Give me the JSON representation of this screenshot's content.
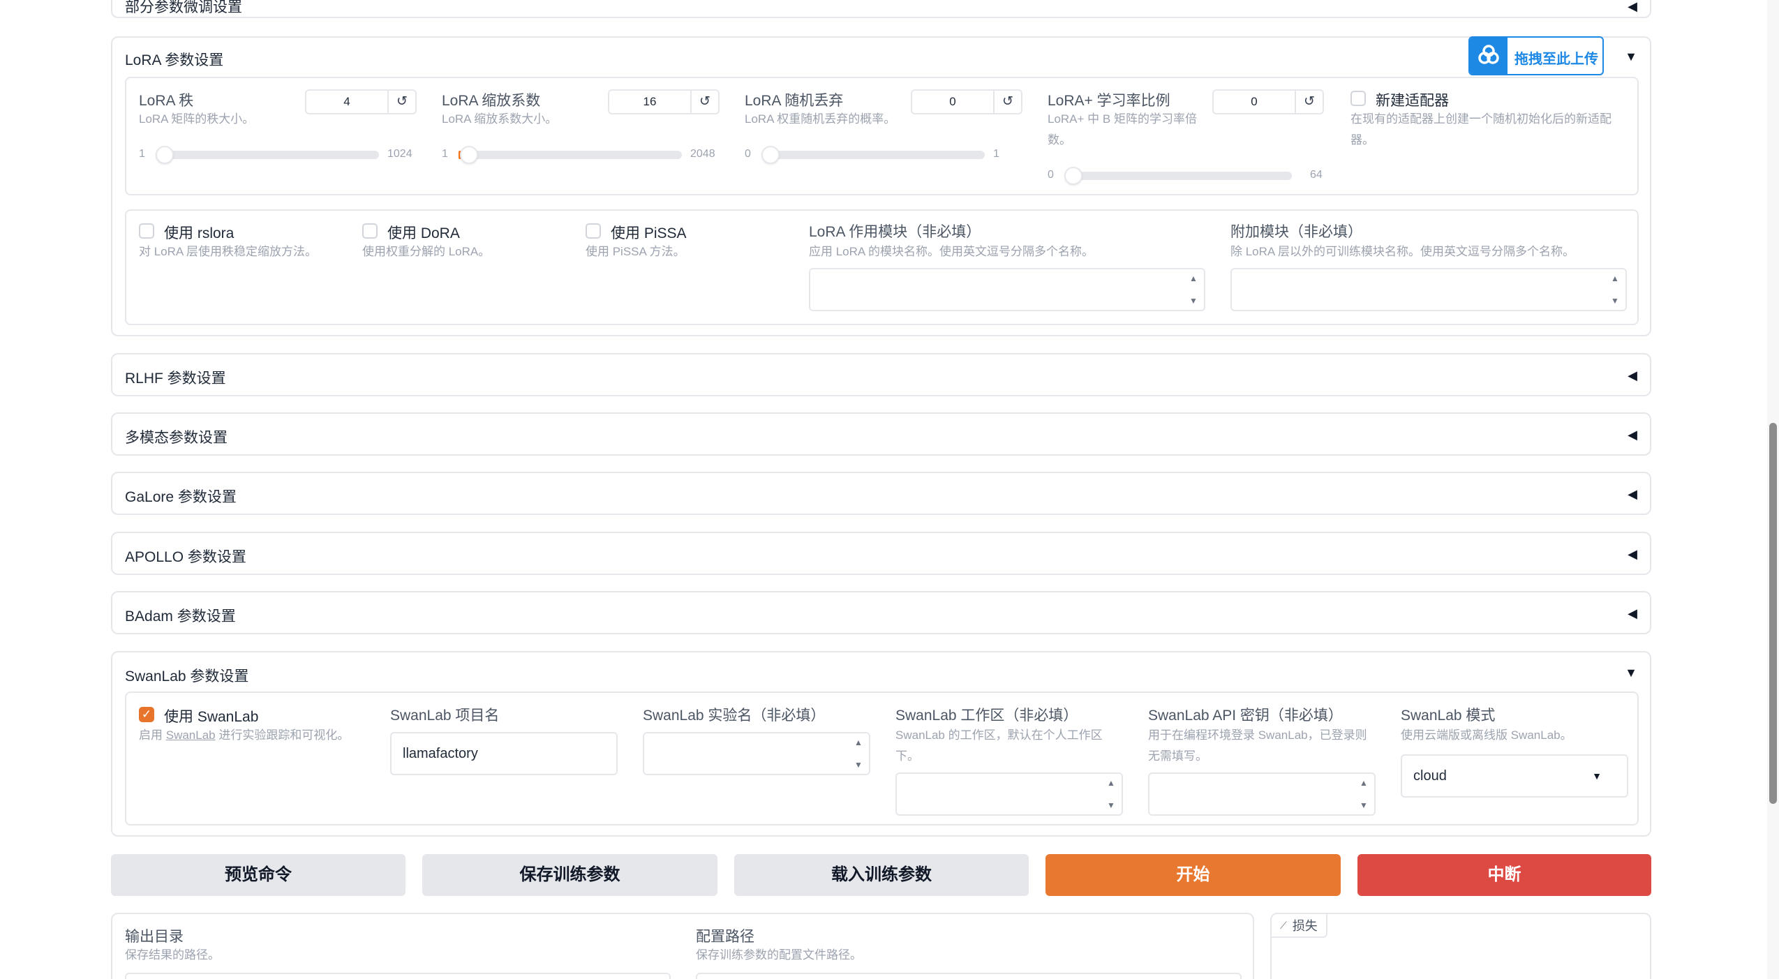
{
  "sections": {
    "partial": {
      "title": "部分参数微调设置"
    },
    "lora": {
      "title": "LoRA 参数设置"
    },
    "rlhf": {
      "title": "RLHF 参数设置"
    },
    "multimodal": {
      "title": "多模态参数设置"
    },
    "galore": {
      "title": "GaLore 参数设置"
    },
    "apollo": {
      "title": "APOLLO 参数设置"
    },
    "badam": {
      "title": "BAdam 参数设置"
    },
    "swanlab": {
      "title": "SwanLab 参数设置"
    }
  },
  "upload_badge": {
    "label": "拖拽至此上传",
    "icon": "cloud-upload-icon",
    "color": "#1e88e5"
  },
  "lora": {
    "rank": {
      "label": "LoRA 秩",
      "info": "LoRA 矩阵的秩大小。",
      "value": "4",
      "min": "1",
      "max": "1024",
      "fraction": 0.003
    },
    "alpha": {
      "label": "LoRA 缩放系数",
      "info": "LoRA 缩放系数大小。",
      "value": "16",
      "min": "1",
      "max": "2048",
      "fraction": 0.007
    },
    "dropout": {
      "label": "LoRA 随机丢弃",
      "info": "LoRA 权重随机丢弃的概率。",
      "value": "0",
      "min": "0",
      "max": "1",
      "fraction": 0
    },
    "plus_ratio": {
      "label": "LoRA+ 学习率比例",
      "info": "LoRA+ 中 B 矩阵的学习率倍数。",
      "value": "0",
      "min": "0",
      "max": "64",
      "fraction": 0
    },
    "create_new_adapter": {
      "label": "新建适配器",
      "info": "在现有的适配器上创建一个随机初始化后的新适配器。",
      "checked": false
    },
    "use_rslora": {
      "label": "使用 rslora",
      "info": "对 LoRA 层使用秩稳定缩放方法。",
      "checked": false
    },
    "use_dora": {
      "label": "使用 DoRA",
      "info": "使用权重分解的 LoRA。",
      "checked": false
    },
    "use_pissa": {
      "label": "使用 PiSSA",
      "info": "使用 PiSSA 方法。",
      "checked": false
    },
    "target": {
      "label": "LoRA 作用模块（非必填）",
      "info": "应用 LoRA 的模块名称。使用英文逗号分隔多个名称。",
      "value": ""
    },
    "additional_target": {
      "label": "附加模块（非必填）",
      "info": "除 LoRA 层以外的可训练模块名称。使用英文逗号分隔多个名称。",
      "value": ""
    }
  },
  "swanlab": {
    "use": {
      "label": "使用 SwanLab",
      "info_prefix": "启用 ",
      "info_link": "SwanLab",
      "info_suffix": " 进行实验跟踪和可视化。",
      "checked": true
    },
    "project": {
      "label": "SwanLab 项目名",
      "value": "llamafactory"
    },
    "run_name": {
      "label": "SwanLab 实验名（非必填）",
      "value": ""
    },
    "workspace": {
      "label": "SwanLab 工作区（非必填）",
      "info": "SwanLab 的工作区，默认在个人工作区下。",
      "value": ""
    },
    "api_key": {
      "label": "SwanLab API 密钥（非必填）",
      "info": "用于在编程环境登录 SwanLab，已登录则无需填写。",
      "value": ""
    },
    "mode": {
      "label": "SwanLab 模式",
      "info": "使用云端版或离线版 SwanLab。",
      "value": "cloud"
    }
  },
  "actions": {
    "preview": "预览命令",
    "save": "保存训练参数",
    "load": "载入训练参数",
    "start": "开始",
    "abort": "中断"
  },
  "output": {
    "output_dir": {
      "label": "输出目录",
      "info": "保存结果的路径。"
    },
    "config_path": {
      "label": "配置路径",
      "info": "保存训练参数的配置文件路径。"
    },
    "loss_tab": {
      "label": "损失",
      "icon": "chart-icon"
    }
  },
  "colors": {
    "accent": "#e8782f",
    "danger": "#dc4a43",
    "checkbox": "#e8742b"
  }
}
